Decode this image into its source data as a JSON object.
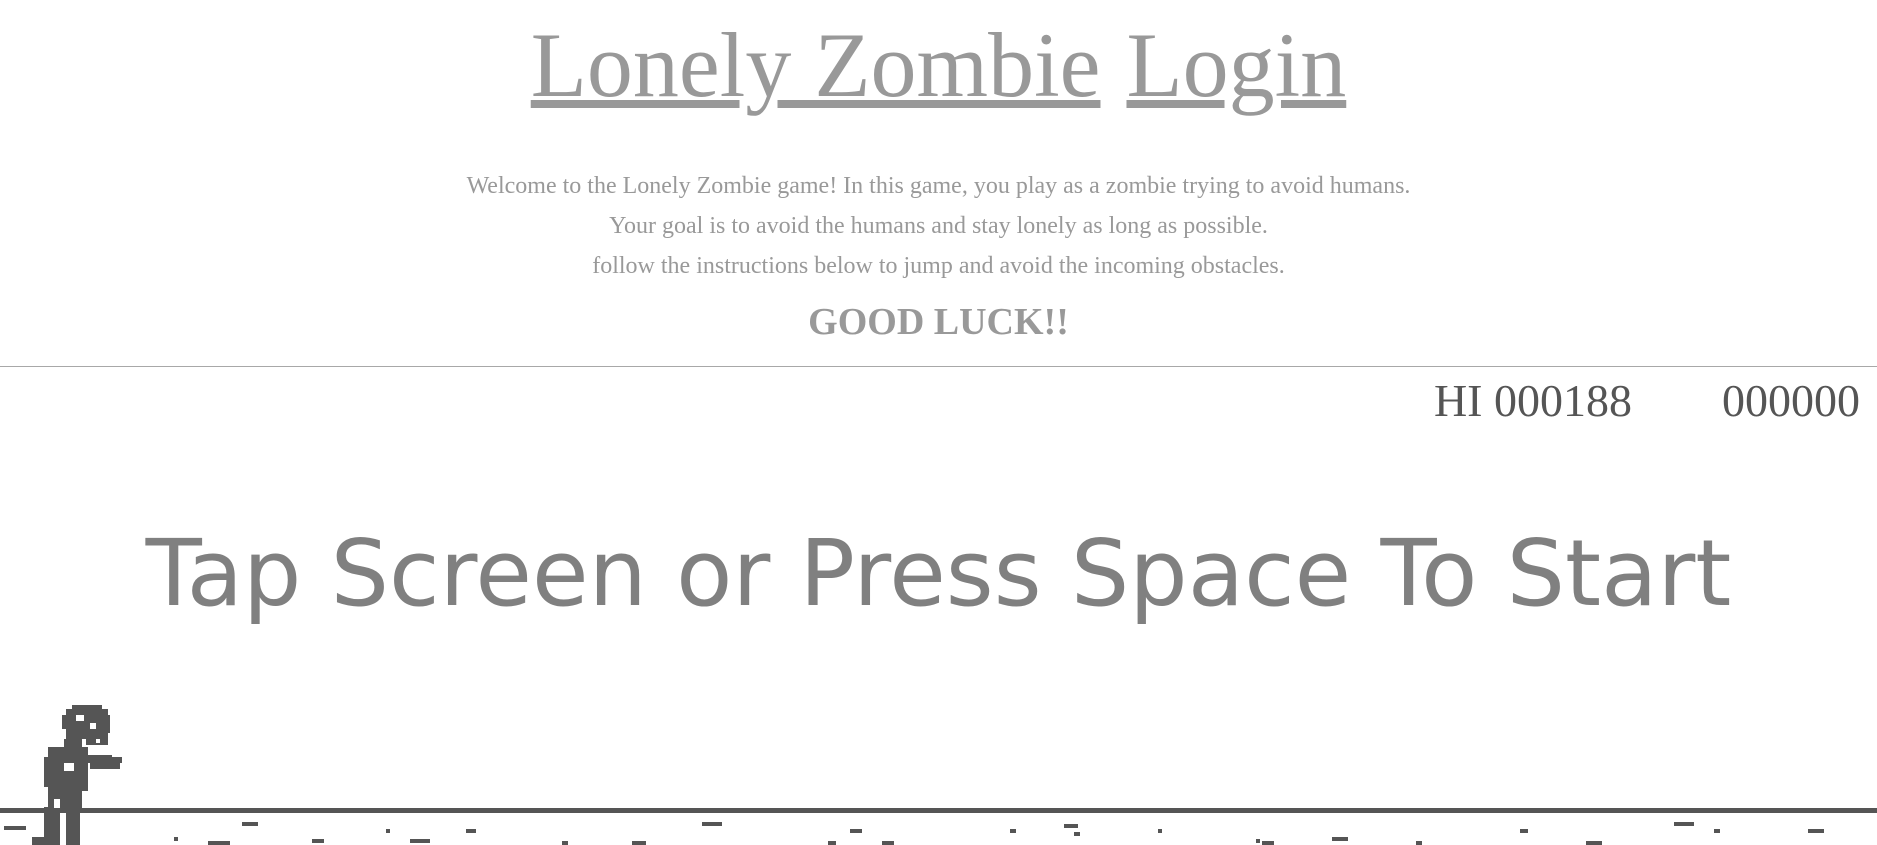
{
  "header": {
    "title_part1": "Lonely Zombie",
    "title_part2": "Login"
  },
  "intro": {
    "line1": "Welcome to the Lonely Zombie game! In this game, you play as a zombie trying to avoid humans.",
    "line2": "Your goal is to avoid the humans and stay lonely as long as possible.",
    "line3": "follow the instructions below to jump and avoid the incoming obstacles.",
    "good_luck": "GOOD LUCK!!"
  },
  "game": {
    "high_score": "HI 000188",
    "current_score": "000000",
    "start_message": "Tap Screen or Press Space To Start",
    "character": "zombie",
    "colors": {
      "ink": "#555555",
      "text": "#999999",
      "start_text": "#808080"
    }
  }
}
